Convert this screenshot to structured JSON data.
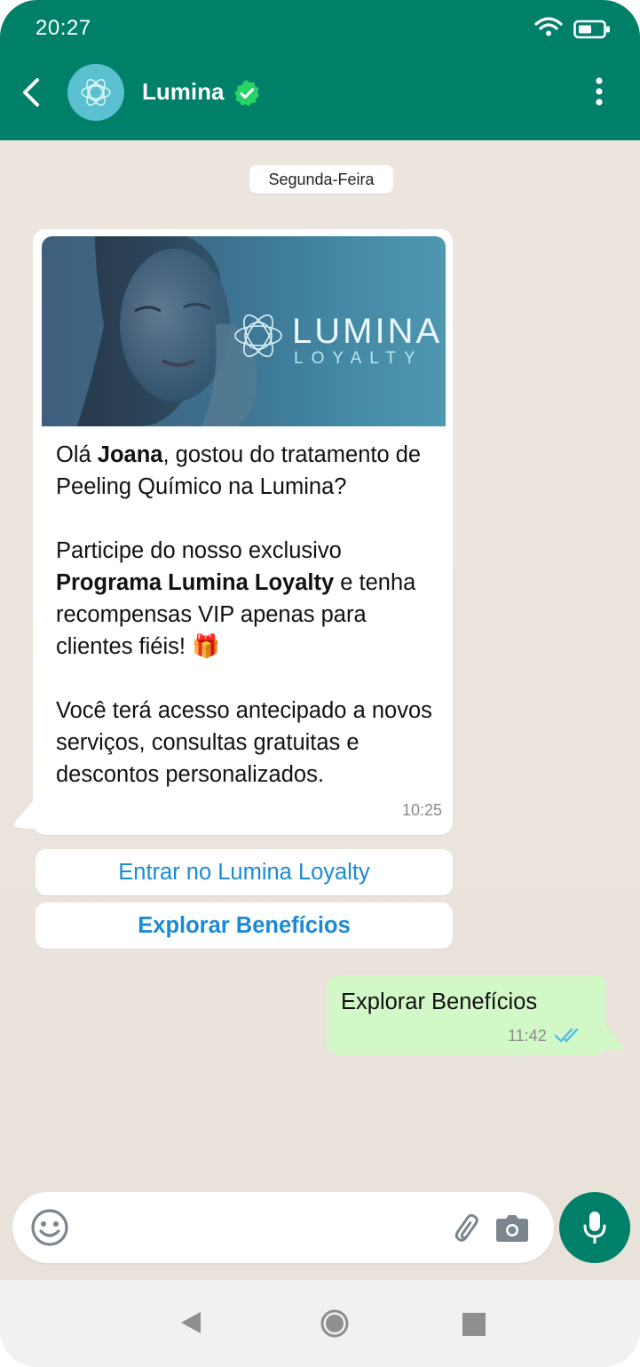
{
  "status_bar": {
    "time": "20:27",
    "wifi_icon": "wifi-icon",
    "battery_icon": "battery-icon"
  },
  "header": {
    "contact_name": "Lumina",
    "verified_icon": "verified-badge-icon",
    "accent": "#008069"
  },
  "chat": {
    "day_label": "Segunda-Feira",
    "incoming": {
      "banner": {
        "brand": "LUMINA",
        "subbrand": "LOYALTY",
        "logo_icon": "lumina-flower-logo"
      },
      "paragraph1": {
        "pre": "Olá ",
        "bold": "Joana",
        "post": ", gostou do tratamento de Peeling Químico na Lumina?"
      },
      "paragraph2": {
        "pre": "Participe do nosso exclusivo ",
        "bold": "Programa Lumina Loyalty",
        "post": " e tenha recompensas VIP apenas para clientes fiéis! ",
        "emoji": "🎁"
      },
      "paragraph3": "Você terá acesso antecipado a novos serviços, consultas gratuitas e descontos personalizados.",
      "time": "10:25"
    },
    "quick_replies": [
      {
        "label": "Entrar no Lumina Loyalty"
      },
      {
        "label": "Explorar Benefícios"
      }
    ],
    "outgoing": {
      "text": "Explorar Benefícios",
      "time": "11:42",
      "read_icon": "double-check-icon",
      "bubble_color": "#d3f8c7"
    }
  },
  "composer": {
    "placeholder": "",
    "emoji_icon": "emoji-icon",
    "attach_icon": "paperclip-icon",
    "camera_icon": "camera-icon",
    "mic_icon": "microphone-icon"
  },
  "nav": {
    "back_icon": "nav-back-icon",
    "home_icon": "nav-home-icon",
    "recents_icon": "nav-recents-icon"
  }
}
